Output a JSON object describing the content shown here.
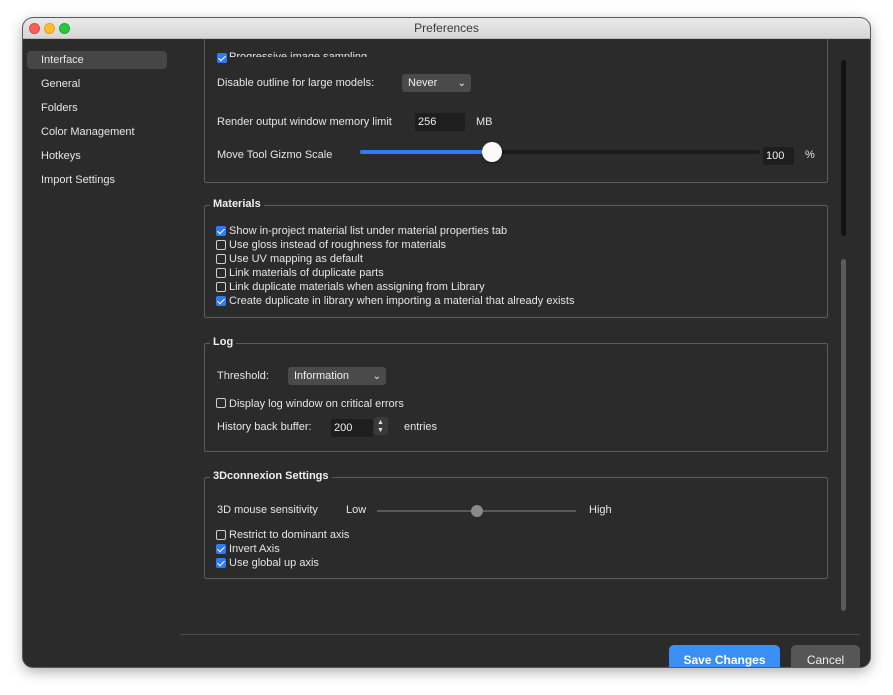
{
  "window": {
    "title": "Preferences"
  },
  "sidebar": {
    "items": [
      {
        "label": "Interface",
        "active": true
      },
      {
        "label": "General"
      },
      {
        "label": "Folders"
      },
      {
        "label": "Color Management"
      },
      {
        "label": "Hotkeys"
      },
      {
        "label": "Import Settings"
      }
    ]
  },
  "interface": {
    "progressive_label": "Progressive image sampling",
    "outline_label": "Disable outline for large models:",
    "outline_value": "Never",
    "memory_label": "Render output window memory limit",
    "memory_value": "256",
    "memory_unit": "MB",
    "gizmo_label": "Move Tool Gizmo Scale",
    "gizmo_value": "100",
    "gizmo_unit": "%",
    "gizmo_fraction": 0.33
  },
  "materials": {
    "title": "Materials",
    "options": [
      {
        "label": "Show in-project material list under material properties tab",
        "checked": true
      },
      {
        "label": "Use gloss instead of roughness for materials",
        "checked": false
      },
      {
        "label": "Use UV mapping as default",
        "checked": false
      },
      {
        "label": "Link materials of duplicate parts",
        "checked": false
      },
      {
        "label": "Link duplicate materials when assigning from Library",
        "checked": false
      },
      {
        "label": "Create duplicate in library when importing a material that already exists",
        "checked": true
      }
    ]
  },
  "log": {
    "title": "Log",
    "threshold_label": "Threshold:",
    "threshold_value": "Information",
    "critical_label": "Display log window on critical errors",
    "critical_checked": false,
    "history_label": "History back buffer:",
    "history_value": "200",
    "history_unit": "entries"
  },
  "connexion": {
    "title": "3Dconnexion Settings",
    "sensitivity_label": "3D mouse sensitivity",
    "low_label": "Low",
    "high_label": "High",
    "sensitivity_fraction": 0.5,
    "options": [
      {
        "label": "Restrict to dominant axis",
        "checked": false
      },
      {
        "label": "Invert Axis",
        "checked": true
      },
      {
        "label": "Use global up axis",
        "checked": true
      }
    ]
  },
  "footer": {
    "save_label": "Save Changes",
    "cancel_label": "Cancel"
  },
  "colors": {
    "accent": "#2f7bf6",
    "primary_button": "#3a8ff7",
    "background": "#2b2b2b"
  }
}
